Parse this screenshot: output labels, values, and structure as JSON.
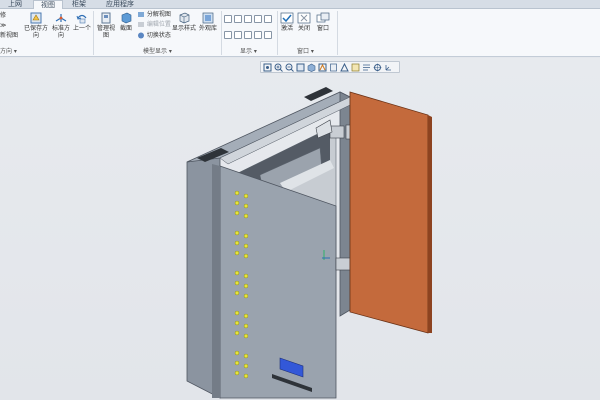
{
  "tabs": [
    {
      "label": "上网",
      "active": false
    },
    {
      "label": "视图",
      "active": true
    },
    {
      "label": "柜架",
      "active": false
    },
    {
      "label": "应用程序",
      "active": false
    }
  ],
  "ribbon": {
    "orientation_group": {
      "items": [
        {
          "label": "已保存方向",
          "icon": "saved-orientation-icon"
        },
        {
          "label": "标准方向",
          "icon": "standard-orientation-icon"
        },
        {
          "label": "上一个",
          "icon": "previous-view-icon"
        }
      ],
      "left_items": [
        "修",
        "≫",
        "新视图"
      ],
      "group_label": "方向 ▾"
    },
    "model_display_group": {
      "items": [
        {
          "label": "管理视图",
          "icon": "manage-views-icon"
        },
        {
          "label": "截面",
          "icon": "section-icon"
        }
      ],
      "small_items": [
        {
          "label": "分解视图",
          "icon": "explode-view-icon",
          "enabled": true
        },
        {
          "label": "编辑位置",
          "icon": "edit-position-icon",
          "enabled": false
        },
        {
          "label": "切换状态",
          "icon": "toggle-status-icon",
          "enabled": true
        }
      ],
      "items2": [
        {
          "label": "显示样式",
          "icon": "display-style-icon"
        },
        {
          "label": "外观库",
          "icon": "appearance-gallery-icon"
        }
      ],
      "group_label": "模型显示 ▾"
    },
    "show_group": {
      "group_label": "显示 ▾"
    },
    "window_group": {
      "items": [
        {
          "label": "激活",
          "icon": "activate-window-icon"
        },
        {
          "label": "关闭",
          "icon": "close-window-icon"
        },
        {
          "label": "窗口",
          "icon": "windows-icon"
        }
      ],
      "group_label": "窗口 ▾"
    }
  },
  "colors": {
    "cabinet_body": "#9aa3ae",
    "cabinet_dark": "#6f7782",
    "door_orange": "#c46a3c",
    "led_yellow": "#e7e43a",
    "display_blue": "#3358d8"
  }
}
